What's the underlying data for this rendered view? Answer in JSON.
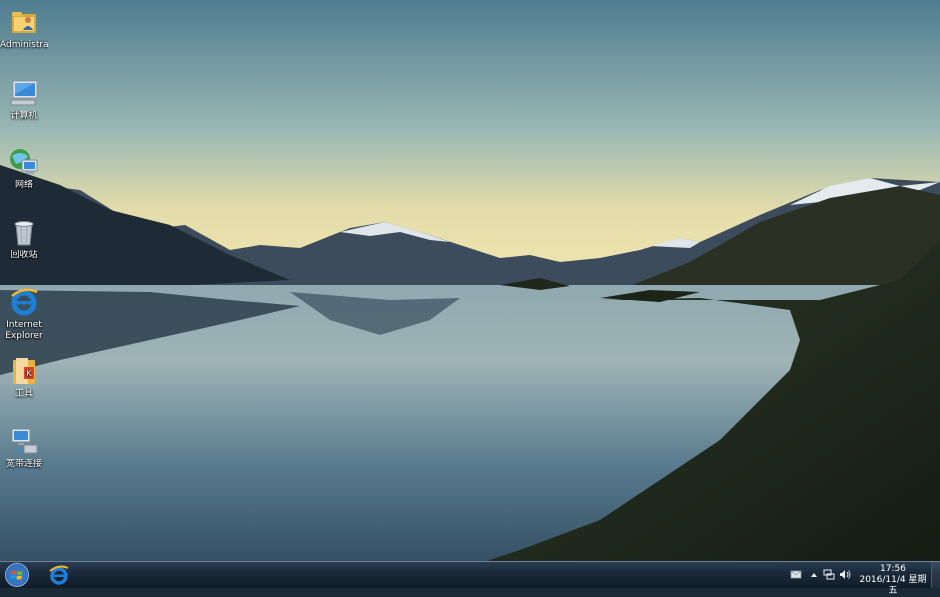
{
  "desktop": {
    "icons": [
      {
        "label": "Administrator",
        "icon": "user-folder-icon"
      },
      {
        "label": "计算机",
        "icon": "computer-icon"
      },
      {
        "label": "网络",
        "icon": "network-icon"
      },
      {
        "label": "回收站",
        "icon": "recycle-bin-icon"
      },
      {
        "label": "Internet Explorer",
        "label_line1": "Internet",
        "label_line2": "Explorer",
        "icon": "internet-explorer-icon"
      },
      {
        "label": "工具",
        "icon": "tools-folder-icon"
      },
      {
        "label": "宽带连接",
        "icon": "broadband-connection-icon"
      }
    ]
  },
  "taskbar": {
    "start_icon": "windows-start-icon",
    "pinned": [
      {
        "icon": "internet-explorer-icon"
      }
    ],
    "tray": {
      "icons": [
        "action-center-icon",
        "show-hidden-icons-icon",
        "network-tray-icon",
        "volume-icon"
      ],
      "time": "17:56",
      "date": "2016/11/4 星期五"
    }
  },
  "colors": {
    "sky_top": "#5a8396",
    "sky_horizon": "#e8dca8",
    "lake": "#3d5c72",
    "hills": "#1e2a1c",
    "taskbar": "#1b2a3b"
  }
}
